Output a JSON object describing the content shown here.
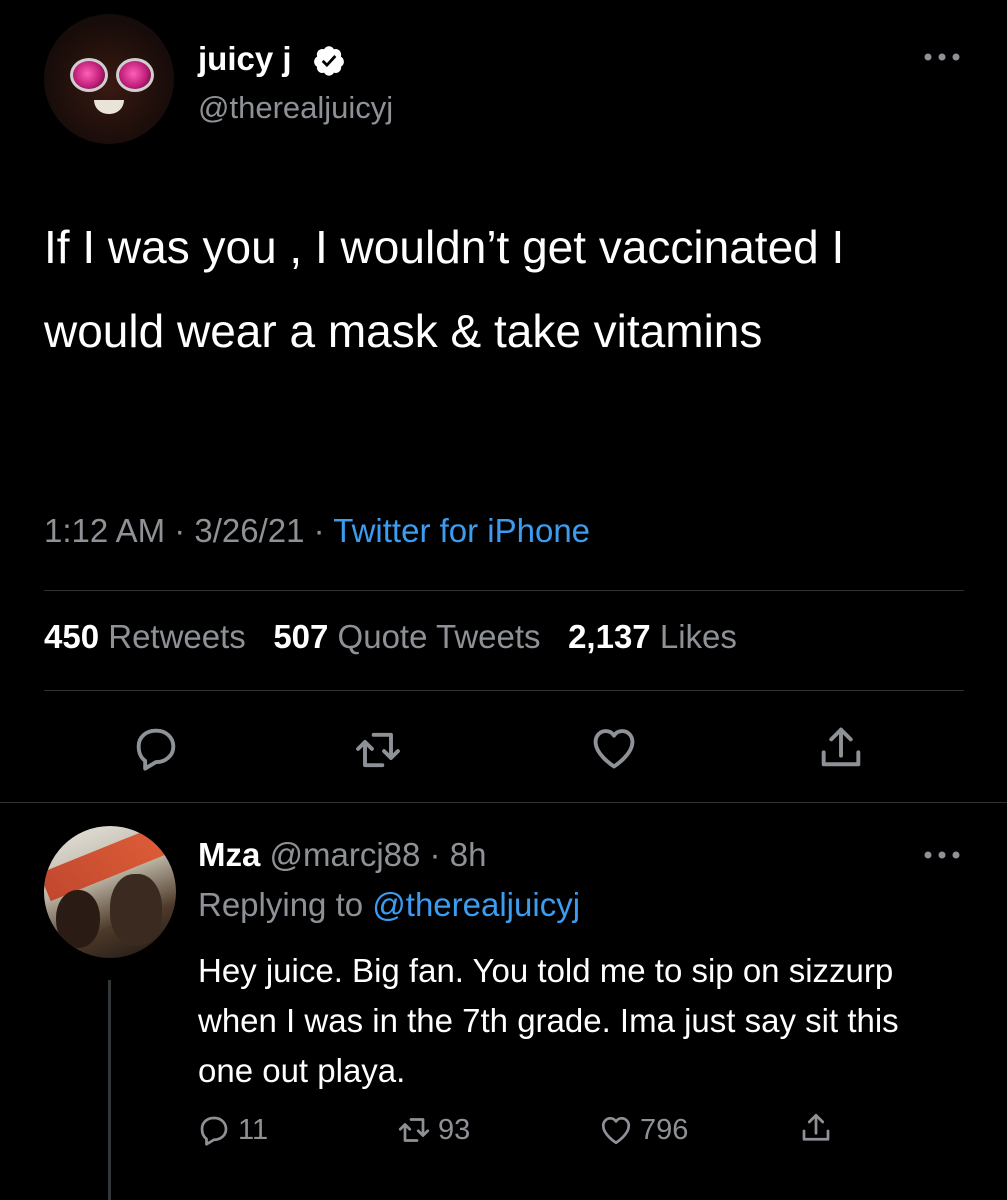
{
  "tweet": {
    "display_name": "juicy j",
    "handle": "@therealjuicyj",
    "text": "If I was you , I wouldn’t get vaccinated I would wear a mask & take vitamins",
    "time": "1:12 AM",
    "date": "3/26/21",
    "separator": " · ",
    "source": "Twitter for iPhone",
    "stats": {
      "retweets_count": "450",
      "retweets_label": "Retweets",
      "quotes_count": "507",
      "quotes_label": "Quote Tweets",
      "likes_count": "2,137",
      "likes_label": "Likes"
    }
  },
  "reply": {
    "display_name": "Mza",
    "handle": "@marcj88",
    "age": "8h",
    "replying_label": "Replying to",
    "replying_to": "@therealjuicyj",
    "text": "Hey juice. Big fan. You told me to sip on sizzurp when I was in the 7th grade. Ima just say sit this one out playa.",
    "counts": {
      "replies": "11",
      "retweets": "93",
      "likes": "796"
    }
  },
  "icons": [
    "verified-icon",
    "more-icon",
    "reply-icon",
    "retweet-icon",
    "like-icon",
    "share-icon"
  ],
  "colors": {
    "background": "#000000",
    "muted": "#8e9297",
    "link": "#3b9cf0",
    "divider": "#2f3336"
  }
}
